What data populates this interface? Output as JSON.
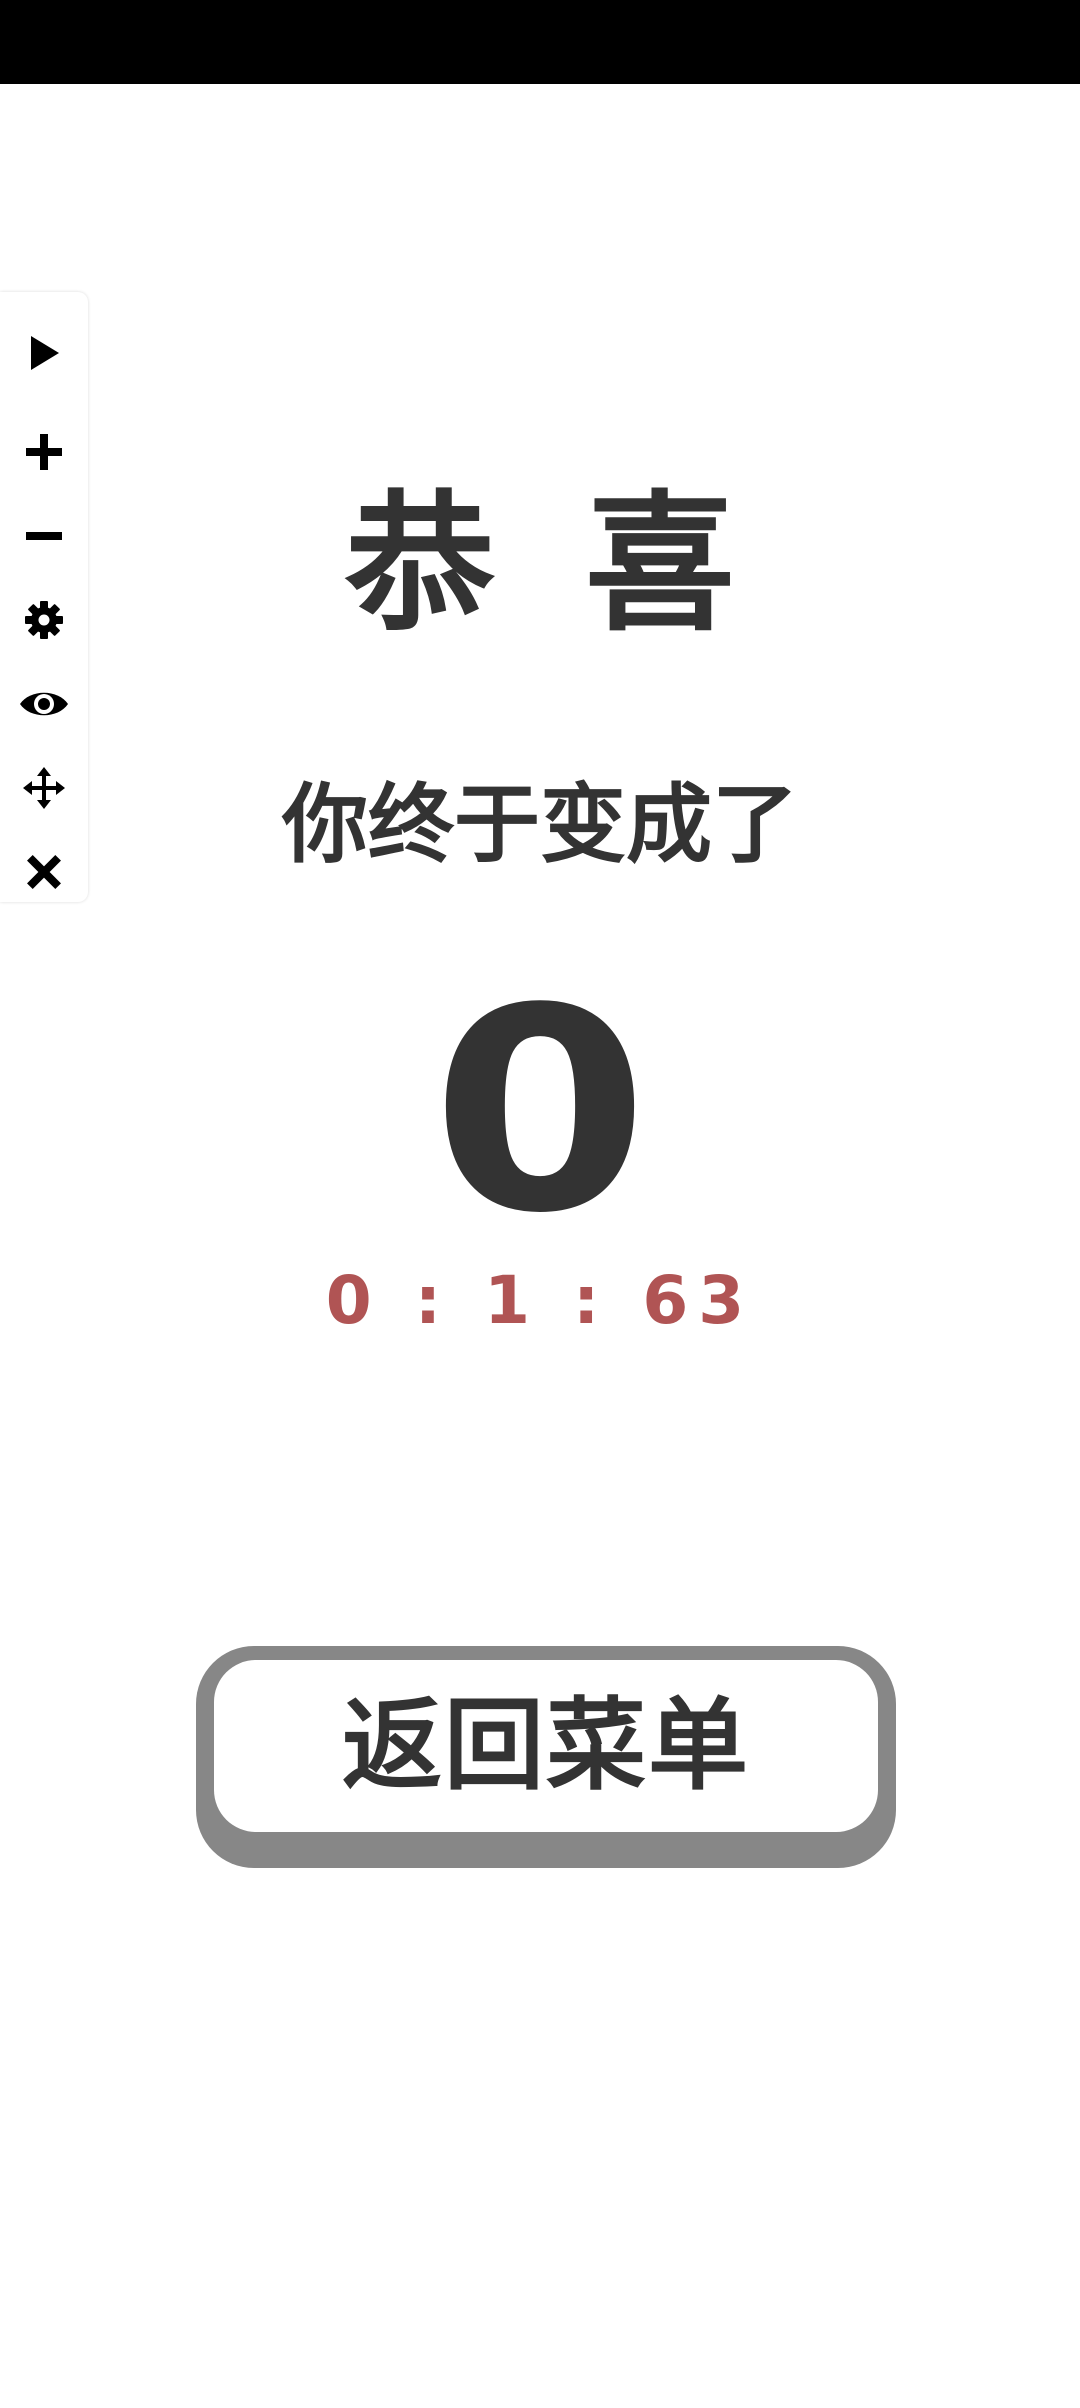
{
  "toolbar": {
    "items": [
      {
        "icon": "play-icon"
      },
      {
        "icon": "plus-icon"
      },
      {
        "icon": "minus-icon"
      },
      {
        "icon": "gear-icon"
      },
      {
        "icon": "eye-icon"
      },
      {
        "icon": "move-icon"
      },
      {
        "icon": "close-icon"
      }
    ]
  },
  "result": {
    "title": "恭喜",
    "subtitle": "你终于变成了",
    "number": "0",
    "time": "0 : 1 : 63"
  },
  "menu_button": {
    "label": "返回菜单"
  },
  "colors": {
    "text": "#333333",
    "timer": "#b05454",
    "button_shadow": "#878787",
    "status_bar": "#000000"
  }
}
